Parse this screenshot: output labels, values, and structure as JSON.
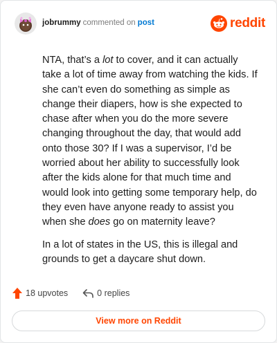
{
  "header": {
    "username": "jobrummy",
    "action_text": "commented on",
    "post_link": "post",
    "brand_name": "reddit",
    "brand_color": "#ff4500"
  },
  "comment": {
    "p1_before": "NTA, that’s a ",
    "p1_em1": "lot",
    "p1_mid": " to cover, and it can actually take a lot of time away from watching the kids. If she can’t even do something as simple as change their diapers, how is she expected to chase after when you do the more severe changing throughout the day, that would add onto those 30? If I was a supervisor, I’d be worried about her ability to successfully look after the kids alone for that much time and would look into getting some temporary help, do they even have anyone ready to assist you when she ",
    "p1_em2": "does",
    "p1_after": " go on maternity leave?",
    "p2": "In a lot of states in the US, this is illegal and grounds to get a daycare shut down."
  },
  "footer": {
    "upvotes_label": "18 upvotes",
    "replies_label": "0 replies",
    "upvote_icon": "upvote-arrow-icon",
    "reply_icon": "reply-arrow-icon"
  },
  "cta": {
    "label": "View more on Reddit"
  }
}
